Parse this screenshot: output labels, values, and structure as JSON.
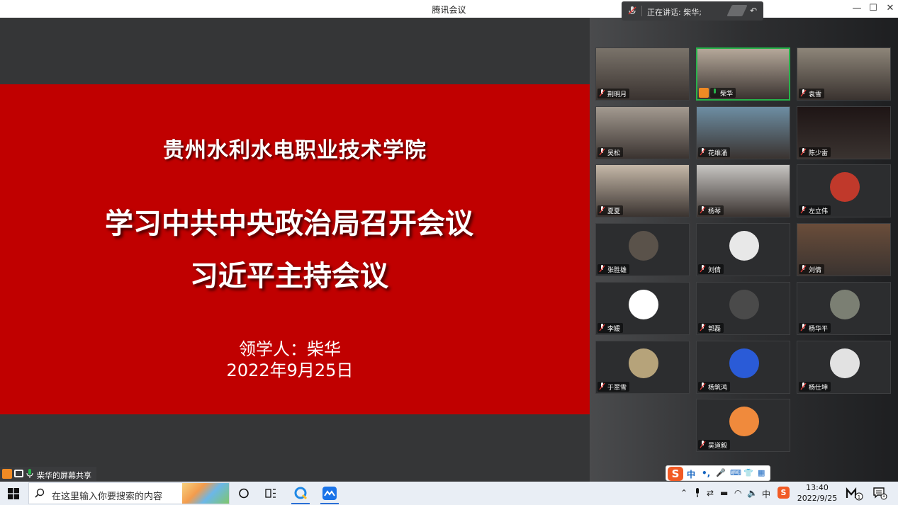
{
  "window": {
    "title": "腾讯会议",
    "speaking_text": "正在讲话: 柴华;",
    "controls": {
      "minimize": "—",
      "maximize": "☐",
      "close": "✕"
    }
  },
  "slide": {
    "school": "贵州水利水电职业技术学院",
    "headline_1": "学习中共中央政治局召开会议",
    "headline_2": "习近平主持会议",
    "leader": "领学人：柴华",
    "date": "2022年9月25日"
  },
  "share_label": "柴华的屏幕共享",
  "participants": [
    {
      "name": "荆明月",
      "kind": "video",
      "color": "#7a736a"
    },
    {
      "name": "柴华",
      "kind": "video",
      "color": "#b5a89a",
      "active": true,
      "host": true
    },
    {
      "name": "袁雪",
      "kind": "video",
      "color": "#8d8579"
    },
    {
      "name": "吴松",
      "kind": "video",
      "color": "#a39a90"
    },
    {
      "name": "花维涌",
      "kind": "video",
      "color": "#6d8ea3"
    },
    {
      "name": "陈少雷",
      "kind": "video",
      "color": "#1e1515"
    },
    {
      "name": "夏夏",
      "kind": "video",
      "color": "#c5b8a8"
    },
    {
      "name": "杨琴",
      "kind": "video",
      "color": "#c7c5c2"
    },
    {
      "name": "左立伟",
      "kind": "avatar",
      "color": "#c0392b"
    },
    {
      "name": "张胜雄",
      "kind": "avatar",
      "color": "#5a524a"
    },
    {
      "name": "刘倩",
      "kind": "avatar",
      "color": "#e8e8e8"
    },
    {
      "name": "刘倩",
      "kind": "video",
      "color": "#6a4d3a"
    },
    {
      "name": "李媛",
      "kind": "avatar",
      "color": "#ffffff"
    },
    {
      "name": "郭磊",
      "kind": "avatar",
      "color": "#4a4a4a"
    },
    {
      "name": "杨华平",
      "kind": "avatar",
      "color": "#7b7f73"
    },
    {
      "name": "于翠雪",
      "kind": "avatar",
      "color": "#b6a37a"
    },
    {
      "name": "杨筑鸿",
      "kind": "avatar",
      "color": "#2a5bd7"
    },
    {
      "name": "杨仕坤",
      "kind": "avatar",
      "color": "#e2e2e2"
    },
    {
      "name": "吴道毅",
      "kind": "avatar",
      "color": "#f08a3c"
    }
  ],
  "ime": {
    "logo": "S",
    "mode": "中",
    "punct": "•,",
    "items": [
      "🎤",
      "⌨",
      "👕",
      "▦"
    ]
  },
  "taskbar": {
    "search_placeholder": "在这里输入你要搜索的内容",
    "time": "13:40",
    "date": "2022/9/25",
    "ime_label": "中",
    "notification_count": "1"
  },
  "colors": {
    "slide_red": "#c00000",
    "active_green": "#27b24a",
    "host_orange": "#f08a24"
  }
}
